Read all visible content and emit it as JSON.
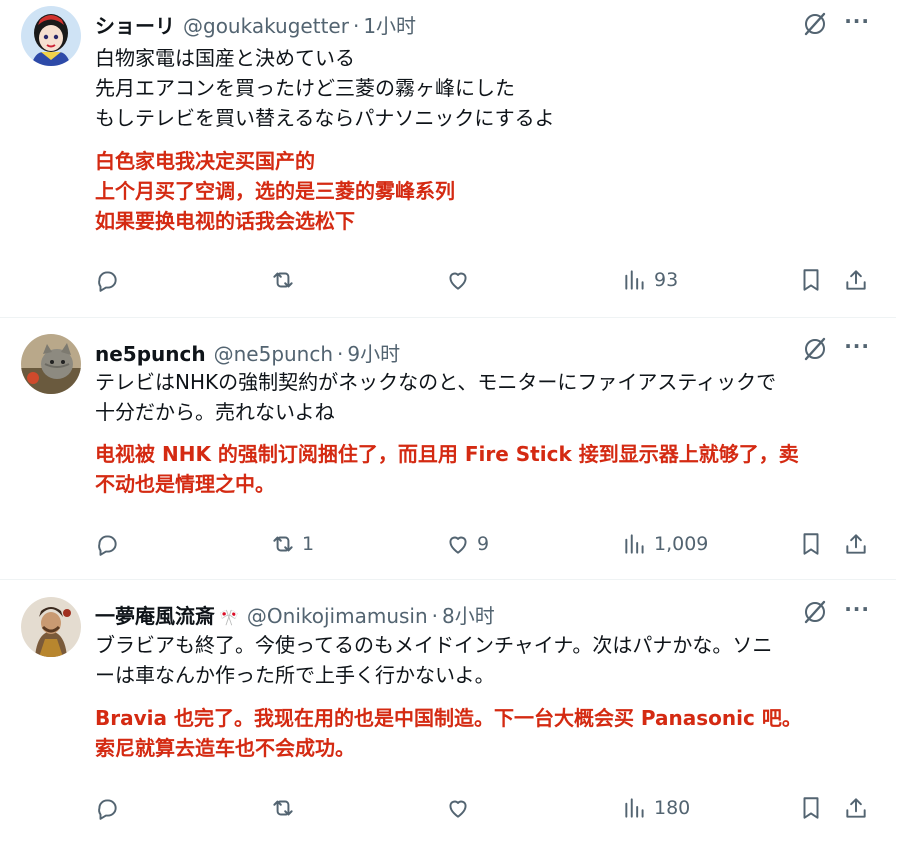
{
  "tweets": [
    {
      "name": "ショーリ",
      "handle": "@goukakugetter",
      "sep": "·",
      "time": "1小时",
      "badge": "",
      "jp": [
        "白物家電は国産と決めている",
        "先月エアコンを買ったけど三菱の霧ヶ峰にした",
        "もしテレビを買い替えるならパナソニックにするよ"
      ],
      "zh": [
        "白色家电我决定买国产的",
        "上个月买了空调，选的是三菱的雾峰系列",
        "如果要换电视的话我会选松下"
      ],
      "stats": {
        "replies": "",
        "reposts": "",
        "likes": "",
        "views": "93"
      }
    },
    {
      "name": "ne5punch",
      "handle": "@ne5punch",
      "sep": "·",
      "time": "9小时",
      "badge": "",
      "jp": [
        "テレビはNHKの強制契約がネックなのと、モニターにファイアスティックで",
        "十分だから。売れないよね"
      ],
      "zh": [
        "电视被 NHK 的强制订阅捆住了，而且用 Fire Stick 接到显示器上就够了，卖",
        "不动也是情理之中。"
      ],
      "stats": {
        "replies": "",
        "reposts": "1",
        "likes": "9",
        "views": "1,009"
      }
    },
    {
      "name": "一夢庵風流斎",
      "handle": "@Onikojimamusin",
      "sep": "·",
      "time": "8小时",
      "badge": "🎌",
      "jp": [
        "ブラビアも終了。今使ってるのもメイドインチャイナ。次はパナかな。ソニ",
        "ーは車なんか作った所で上手く行かないよ。"
      ],
      "zh": [
        "Bravia 也完了。我现在用的也是中国制造。下一台大概会买 Panasonic 吧。",
        "索尼就算去造车也不会成功。"
      ],
      "stats": {
        "replies": "",
        "reposts": "",
        "likes": "",
        "views": "180"
      }
    }
  ],
  "icons": {
    "reply": "reply-icon",
    "repost": "repost-icon",
    "like": "like-icon",
    "views": "views-icon",
    "bookmark": "bookmark-icon",
    "share": "share-icon",
    "grok": "grok-icon",
    "more": "more-icon"
  },
  "more_label": "···",
  "colors": {
    "accent_red": "#d42a12",
    "muted": "#536471",
    "text": "#0f1419"
  }
}
